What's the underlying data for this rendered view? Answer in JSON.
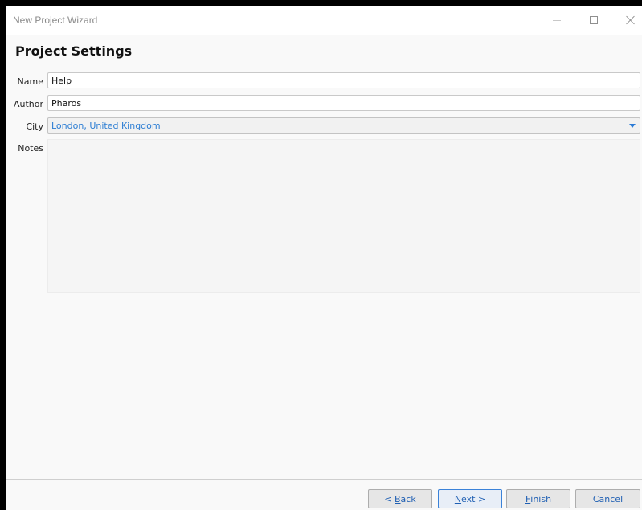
{
  "window": {
    "title": "New Project Wizard"
  },
  "page": {
    "heading": "Project Settings"
  },
  "form": {
    "name_label": "Name",
    "name_value": "Help",
    "author_label": "Author",
    "author_value": "Pharos",
    "city_label": "City",
    "city_value": "London, United Kingdom",
    "notes_label": "Notes",
    "notes_value": ""
  },
  "buttons": {
    "back": {
      "prefix": "< ",
      "mnemonic": "B",
      "rest": "ack"
    },
    "next": {
      "mnemonic": "N",
      "rest": "ext >"
    },
    "finish": {
      "mnemonic": "F",
      "rest": "inish"
    },
    "cancel": {
      "label": "Cancel"
    }
  },
  "colors": {
    "accent": "#2b7bd6",
    "button_text": "#1f5fb3"
  },
  "icons": {
    "minimize": "minimize-icon",
    "maximize": "maximize-icon",
    "close": "close-icon",
    "dropdown": "chevron-down-icon"
  }
}
